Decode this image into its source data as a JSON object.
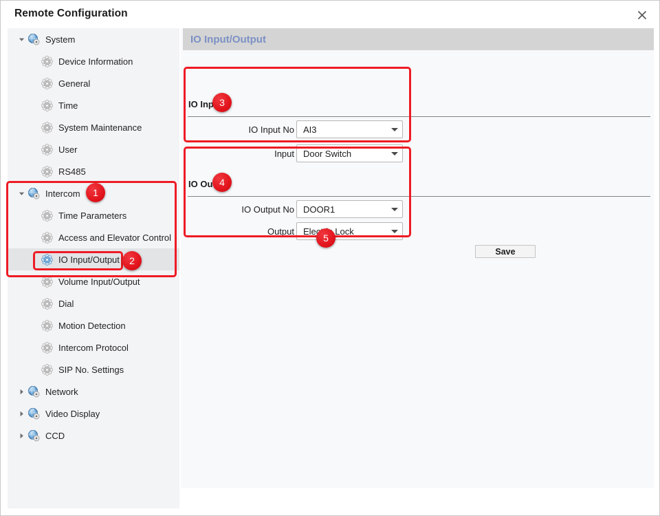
{
  "window": {
    "title": "Remote Configuration",
    "close_icon": "close-icon"
  },
  "sidebar": {
    "items": [
      {
        "label": "System",
        "depth": 0,
        "expanded": true,
        "icon": "globe-gear-icon",
        "selected": false
      },
      {
        "label": "Device Information",
        "depth": 1,
        "expanded": null,
        "icon": "gear-icon",
        "selected": false
      },
      {
        "label": "General",
        "depth": 1,
        "expanded": null,
        "icon": "gear-icon",
        "selected": false
      },
      {
        "label": "Time",
        "depth": 1,
        "expanded": null,
        "icon": "gear-icon",
        "selected": false
      },
      {
        "label": "System Maintenance",
        "depth": 1,
        "expanded": null,
        "icon": "gear-icon",
        "selected": false
      },
      {
        "label": "User",
        "depth": 1,
        "expanded": null,
        "icon": "gear-icon",
        "selected": false
      },
      {
        "label": "RS485",
        "depth": 1,
        "expanded": null,
        "icon": "gear-icon",
        "selected": false
      },
      {
        "label": "Intercom",
        "depth": 0,
        "expanded": true,
        "icon": "globe-gear-icon",
        "selected": false
      },
      {
        "label": "Time Parameters",
        "depth": 1,
        "expanded": null,
        "icon": "gear-icon",
        "selected": false
      },
      {
        "label": "Access and Elevator Control",
        "depth": 1,
        "expanded": null,
        "icon": "gear-icon",
        "selected": false
      },
      {
        "label": "IO Input/Output",
        "depth": 1,
        "expanded": null,
        "icon": "gear-icon-active",
        "selected": true
      },
      {
        "label": "Volume Input/Output",
        "depth": 1,
        "expanded": null,
        "icon": "gear-icon",
        "selected": false
      },
      {
        "label": "Dial",
        "depth": 1,
        "expanded": null,
        "icon": "gear-icon",
        "selected": false
      },
      {
        "label": "Motion Detection",
        "depth": 1,
        "expanded": null,
        "icon": "gear-icon",
        "selected": false
      },
      {
        "label": "Intercom Protocol",
        "depth": 1,
        "expanded": null,
        "icon": "gear-icon",
        "selected": false
      },
      {
        "label": "SIP No. Settings",
        "depth": 1,
        "expanded": null,
        "icon": "gear-icon",
        "selected": false
      },
      {
        "label": "Network",
        "depth": 0,
        "expanded": false,
        "icon": "globe-gear-icon",
        "selected": false
      },
      {
        "label": "Video Display",
        "depth": 0,
        "expanded": false,
        "icon": "globe-gear-icon",
        "selected": false
      },
      {
        "label": "CCD",
        "depth": 0,
        "expanded": false,
        "icon": "globe-gear-icon",
        "selected": false
      }
    ]
  },
  "content": {
    "header_title": "IO Input/Output",
    "io_input": {
      "group_title": "IO Input",
      "fields": [
        {
          "label": "IO Input No",
          "value": "AI3"
        },
        {
          "label": "Input",
          "value": "Door Switch"
        }
      ]
    },
    "io_output": {
      "group_title": "IO Output",
      "fields": [
        {
          "label": "IO Output No",
          "value": "DOOR1"
        },
        {
          "label": "Output",
          "value": "Electric Lock"
        }
      ],
      "save_label": "Save"
    }
  },
  "annotations": {
    "badges": [
      {
        "number": "1"
      },
      {
        "number": "2"
      },
      {
        "number": "3"
      },
      {
        "number": "4"
      },
      {
        "number": "5"
      }
    ],
    "color": "#ee1b24"
  }
}
